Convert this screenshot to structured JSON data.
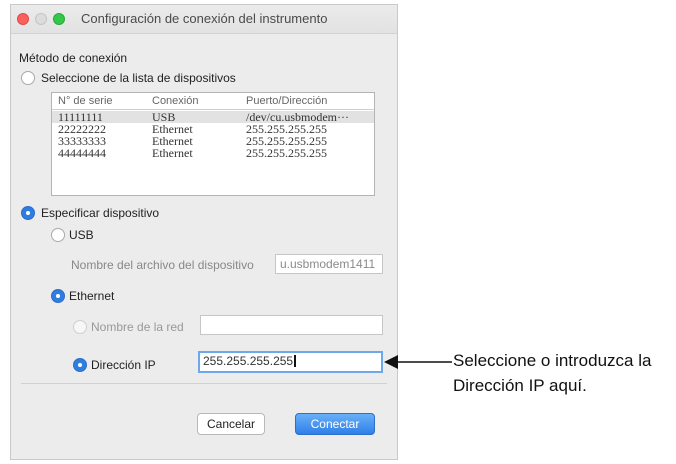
{
  "window": {
    "title": "Configuración de conexión del instrumento"
  },
  "connection_method": {
    "heading": "Método de conexión",
    "option_list_label": "Seleccione de la lista de dispositivos",
    "option_list_selected": false,
    "list": {
      "columns": [
        "N° de serie",
        "Conexión",
        "Puerto/Dirección"
      ],
      "rows": [
        [
          "11111111",
          "USB",
          "/dev/cu.usbmodem···"
        ],
        [
          "22222222",
          "Ethernet",
          "255.255.255.255"
        ],
        [
          "33333333",
          "Ethernet",
          "255.255.255.255"
        ],
        [
          "44444444",
          "Ethernet",
          "255.255.255.255"
        ]
      ],
      "selected_row": 0
    },
    "option_specify_label": "Especificar dispositivo",
    "option_specify_selected": true,
    "usb": {
      "label": "USB",
      "selected": false,
      "file_label": "Nombre del archivo del dispositivo",
      "file_value": "u.usbmodem1411"
    },
    "ethernet": {
      "label": "Ethernet",
      "selected": true,
      "network_name_label": "Nombre de la red",
      "network_name_value": "",
      "ip_label": "Dirección IP",
      "ip_value": "255.255.255.255"
    }
  },
  "buttons": {
    "cancel": "Cancelar",
    "connect": "Conectar"
  },
  "annotation": {
    "line1": "Seleccione o introduzca la",
    "line2": "Dirección IP aquí."
  }
}
